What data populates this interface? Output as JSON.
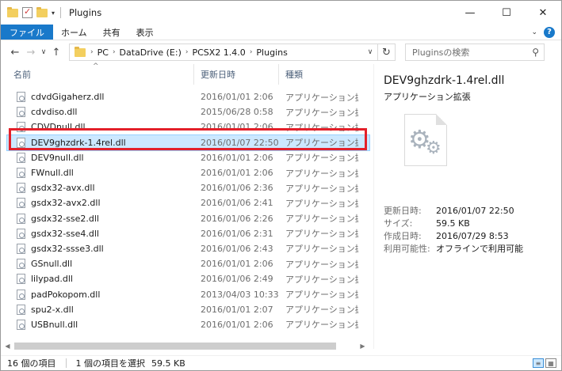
{
  "window": {
    "title": "Plugins",
    "minimize_glyph": "—",
    "maximize_glyph": "☐",
    "close_glyph": "✕"
  },
  "quick_access": {
    "dropdown_glyph": "▾"
  },
  "ribbon": {
    "tabs": [
      "ファイル",
      "ホーム",
      "共有",
      "表示"
    ],
    "expand_glyph": "⌄",
    "help_glyph": "?"
  },
  "nav": {
    "back_glyph": "←",
    "forward_glyph": "→",
    "recent_glyph": "∨",
    "up_glyph": "↑",
    "breadcrumb": [
      "PC",
      "DataDrive (E:)",
      "PCSX2 1.4.0",
      "Plugins"
    ],
    "crumb_sep": "›",
    "address_dropdown_glyph": "∨",
    "refresh_glyph": "↻"
  },
  "search": {
    "placeholder": "Pluginsの検索",
    "icon_glyph": "⚲"
  },
  "columns": {
    "name": "名前",
    "date": "更新日時",
    "type": "種類",
    "sort_glyph": "^"
  },
  "files": [
    {
      "name": "cdvdGigaherz.dll",
      "date": "2016/01/01 2:06",
      "type": "アプリケーション拡張"
    },
    {
      "name": "cdvdiso.dll",
      "date": "2015/06/28 0:58",
      "type": "アプリケーション拡張"
    },
    {
      "name": "CDVDnull.dll",
      "date": "2016/01/01 2:06",
      "type": "アプリケーション拡張"
    },
    {
      "name": "DEV9ghzdrk-1.4rel.dll",
      "date": "2016/01/07 22:50",
      "type": "アプリケーション拡張"
    },
    {
      "name": "DEV9null.dll",
      "date": "2016/01/01 2:06",
      "type": "アプリケーション拡張"
    },
    {
      "name": "FWnull.dll",
      "date": "2016/01/01 2:06",
      "type": "アプリケーション拡張"
    },
    {
      "name": "gsdx32-avx.dll",
      "date": "2016/01/06 2:36",
      "type": "アプリケーション拡張"
    },
    {
      "name": "gsdx32-avx2.dll",
      "date": "2016/01/06 2:41",
      "type": "アプリケーション拡張"
    },
    {
      "name": "gsdx32-sse2.dll",
      "date": "2016/01/06 2:26",
      "type": "アプリケーション拡張"
    },
    {
      "name": "gsdx32-sse4.dll",
      "date": "2016/01/06 2:31",
      "type": "アプリケーション拡張"
    },
    {
      "name": "gsdx32-ssse3.dll",
      "date": "2016/01/06 2:43",
      "type": "アプリケーション拡張"
    },
    {
      "name": "GSnull.dll",
      "date": "2016/01/01 2:06",
      "type": "アプリケーション拡張"
    },
    {
      "name": "lilypad.dll",
      "date": "2016/01/06 2:49",
      "type": "アプリケーション拡張"
    },
    {
      "name": "padPokopom.dll",
      "date": "2013/04/03 10:33",
      "type": "アプリケーション拡張"
    },
    {
      "name": "spu2-x.dll",
      "date": "2016/01/01 2:07",
      "type": "アプリケーション拡張"
    },
    {
      "name": "USBnull.dll",
      "date": "2016/01/01 2:06",
      "type": "アプリケーション拡張"
    }
  ],
  "selected_index": 3,
  "details": {
    "filename": "DEV9ghzdrk-1.4rel.dll",
    "filetype": "アプリケーション拡張",
    "props": [
      {
        "k": "更新日時:",
        "v": "2016/01/07 22:50"
      },
      {
        "k": "サイズ:",
        "v": "59.5 KB"
      },
      {
        "k": "作成日時:",
        "v": "2016/07/29 8:53"
      },
      {
        "k": "利用可能性:",
        "v": "オフラインで利用可能"
      }
    ]
  },
  "scrollbar": {
    "left_glyph": "◀",
    "right_glyph": "▶"
  },
  "status": {
    "item_count": "16 個の項目",
    "selection": "1 個の項目を選択",
    "size": "59.5 KB"
  },
  "colors": {
    "accent": "#1979ca",
    "selection": "#cce8ff",
    "highlight_annotation": "#e3202a"
  }
}
